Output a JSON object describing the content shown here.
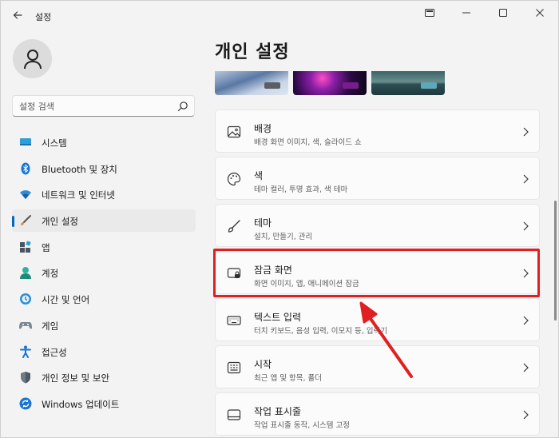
{
  "app": {
    "title": "설정"
  },
  "window_controls": {
    "snap": "⧉",
    "minimize": "—",
    "maximize": "☐",
    "close": "✕"
  },
  "sidebar": {
    "search_placeholder": "설정 검색",
    "items": [
      {
        "label": "시스템",
        "icon": "system-icon"
      },
      {
        "label": "Bluetooth 및 장치",
        "icon": "bluetooth-icon"
      },
      {
        "label": "네트워크 및 인터넷",
        "icon": "network-icon"
      },
      {
        "label": "개인 설정",
        "icon": "personalization-brush-icon",
        "active": true
      },
      {
        "label": "앱",
        "icon": "apps-icon"
      },
      {
        "label": "계정",
        "icon": "accounts-icon"
      },
      {
        "label": "시간 및 언어",
        "icon": "time-language-icon"
      },
      {
        "label": "게임",
        "icon": "gaming-icon"
      },
      {
        "label": "접근성",
        "icon": "accessibility-icon"
      },
      {
        "label": "개인 정보 및 보안",
        "icon": "privacy-shield-icon"
      },
      {
        "label": "Windows 업데이트",
        "icon": "windows-update-icon"
      }
    ]
  },
  "main": {
    "title": "개인 설정",
    "cards": [
      {
        "title": "배경",
        "desc": "배경 화면 이미지, 색, 슬라이드 쇼",
        "icon": "background-image-icon"
      },
      {
        "title": "색",
        "desc": "테마 컬러, 투명 효과, 색 테마",
        "icon": "color-palette-icon"
      },
      {
        "title": "테마",
        "desc": "설치, 만들기, 관리",
        "icon": "theme-brush-icon"
      },
      {
        "title": "잠금 화면",
        "desc": "화면 이미지, 앱, 애니메이션 잠금",
        "icon": "lock-screen-icon"
      },
      {
        "title": "텍스트 입력",
        "desc": "터치 키보드, 음성 입력, 이모지 등, 입력기",
        "icon": "keyboard-icon"
      },
      {
        "title": "시작",
        "desc": "최근 앱 및 항목, 폴더",
        "icon": "start-menu-icon"
      },
      {
        "title": "작업 표시줄",
        "desc": "작업 표시줄 동작, 시스템 고정",
        "icon": "taskbar-icon"
      }
    ]
  },
  "colors": {
    "accent": "#0067c0",
    "highlight": "#e02020"
  }
}
